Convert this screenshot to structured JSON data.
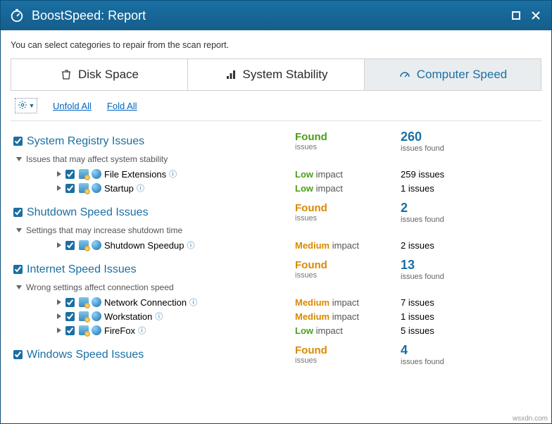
{
  "title": "BoostSpeed: Report",
  "intro": "You can select categories to repair from the scan report.",
  "tabs": {
    "disk": "Disk Space",
    "stability": "System Stability",
    "speed": "Computer Speed"
  },
  "toolbar": {
    "unfold": "Unfold All",
    "fold": "Fold All"
  },
  "labels": {
    "issues": "issues",
    "issues_found": "issues found",
    "impact": " impact",
    "issues_suffix": " issues"
  },
  "impact": {
    "low": "Low",
    "medium": "Medium"
  },
  "cats": [
    {
      "title": "System Registry Issues",
      "sub": "Issues that may affect system stability",
      "found_color": "green",
      "found": "Found",
      "count": "260",
      "items": [
        {
          "name": "File Extensions",
          "impact": "low",
          "count": "259"
        },
        {
          "name": "Startup",
          "impact": "low",
          "count": "1"
        }
      ]
    },
    {
      "title": "Shutdown Speed Issues",
      "sub": "Settings that may increase shutdown time",
      "found_color": "orange",
      "found": "Found",
      "count": "2",
      "items": [
        {
          "name": "Shutdown Speedup",
          "impact": "medium",
          "count": "2"
        }
      ]
    },
    {
      "title": "Internet Speed Issues",
      "sub": "Wrong settings affect connection speed",
      "found_color": "orange",
      "found": "Found",
      "count": "13",
      "items": [
        {
          "name": "Network Connection",
          "impact": "medium",
          "count": "7"
        },
        {
          "name": "Workstation",
          "impact": "medium",
          "count": "1"
        },
        {
          "name": "FireFox",
          "impact": "low",
          "count": "5"
        }
      ]
    },
    {
      "title": "Windows Speed Issues",
      "sub": "",
      "found_color": "orange",
      "found": "Found",
      "count": "4",
      "items": []
    }
  ],
  "watermark": "wsxdn.com"
}
